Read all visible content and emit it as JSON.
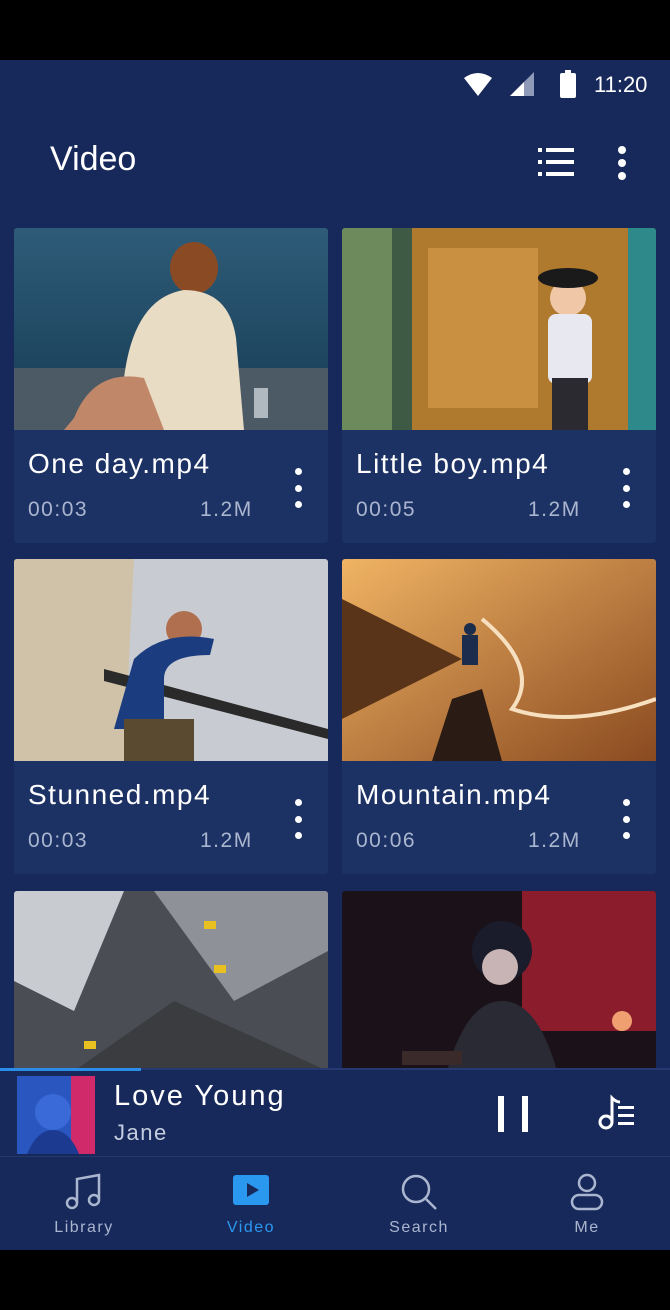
{
  "status_bar": {
    "time": "11:20"
  },
  "header": {
    "title": "Video"
  },
  "videos": [
    {
      "name": "One day.mp4",
      "duration": "00:03",
      "size": "1.2M"
    },
    {
      "name": "Little boy.mp4",
      "duration": "00:05",
      "size": "1.2M"
    },
    {
      "name": "Stunned.mp4",
      "duration": "00:03",
      "size": "1.2M"
    },
    {
      "name": "Mountain.mp4",
      "duration": "00:06",
      "size": "1.2M"
    }
  ],
  "player": {
    "song": "Love Young",
    "artist": "Jane",
    "progress": 0.21
  },
  "nav": {
    "items": [
      {
        "label": "Library",
        "icon": "music-note-icon"
      },
      {
        "label": "Video",
        "icon": "play-icon",
        "active": true
      },
      {
        "label": "Search",
        "icon": "search-icon"
      },
      {
        "label": "Me",
        "icon": "user-icon"
      }
    ]
  },
  "colors": {
    "background": "#17295a",
    "card": "#1d3264",
    "accent": "#2b98f0"
  }
}
